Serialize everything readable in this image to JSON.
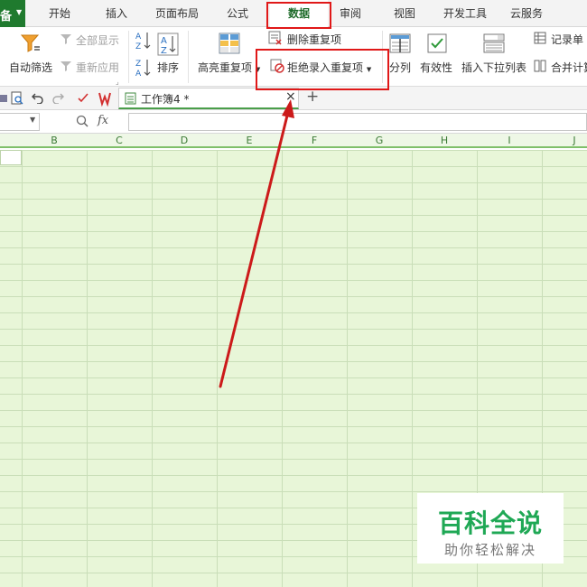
{
  "menu": {
    "corner_label": "备",
    "tabs": [
      "开始",
      "插入",
      "页面布局",
      "公式",
      "数据",
      "审阅",
      "视图",
      "开发工具",
      "云服务"
    ],
    "active_tab": "数据"
  },
  "ribbon": {
    "auto_filter": "自动筛选",
    "show_all": "全部显示",
    "reapply": "重新应用",
    "sort": "排序",
    "highlight_dup": "高亮重复项",
    "delete_dup": "删除重复项",
    "reject_dup": "拒绝录入重复项",
    "split_col": "分列",
    "validity": "有效性",
    "insert_dropdown": "插入下拉列表",
    "record_sheet": "记录单",
    "consolidate": "合并计算"
  },
  "quickbar": {
    "doc_tab": "工作簿4 *",
    "close": "×",
    "add": "+"
  },
  "formula_bar": {
    "fx": "fx"
  },
  "columns": [
    "B",
    "C",
    "D",
    "E",
    "F",
    "G",
    "H",
    "I",
    "J"
  ],
  "watermark": {
    "title": "百科全说",
    "subtitle": "助你轻松解决"
  },
  "colors": {
    "accent_green": "#1e6b2a",
    "grid_fill": "#e8f6d8",
    "highlight_red": "#e01818",
    "watermark_green": "#1fa855"
  }
}
